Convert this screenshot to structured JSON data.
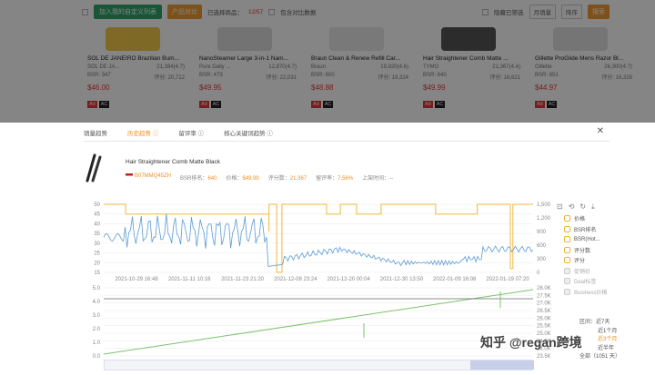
{
  "background": {
    "topbar": {
      "custom_list_button": "加入我的自定义列表",
      "product_button": "产品对比",
      "selected_text": "已选择商品：",
      "selected_count": "12/57",
      "compare_text": "包含对比数据",
      "filter_hidden": "隐藏已筛选",
      "sort_label": "月销量",
      "order_label": "降序",
      "search_button": "搜索"
    },
    "cards": [
      {
        "title": "SOL DE JANEIRO Brazilian Bum...",
        "brand": "SOL DE JA...",
        "rank": "21,384(4.7)",
        "bsr": "BSR: 347",
        "sub": "评分: 20,712",
        "price": "$46.00"
      },
      {
        "title": "NanoSteamer Large 3-in-1 Nam...",
        "brand": "Pure Daily ...",
        "rank": "12,870(4.7)",
        "bsr": "BSR: 473",
        "sub": "评分: 22,031",
        "price": "$49.95"
      },
      {
        "title": "Braun Clean & Renew Refill Car...",
        "brand": "Braun",
        "rank": "19,820(4.6)",
        "bsr": "BSR: 600",
        "sub": "评分: 19,324",
        "price": "$48.88"
      },
      {
        "title": "Hair Straightener Comb Matte ...",
        "brand": "TYMO",
        "rank": "21,367(4.4)",
        "bsr": "BSR: 640",
        "sub": "评分: 16,621",
        "price": "$49.99"
      },
      {
        "title": "Gillette ProGlide Mens Razor Bl...",
        "brand": "Gillette",
        "rank": "26,300(4.7)",
        "bsr": "BSR: 651",
        "sub": "评分: 16,328",
        "price": "$44.97"
      }
    ],
    "tag_ad": "Ad",
    "tag_ac": "AC"
  },
  "panel": {
    "tabs": [
      "销量趋势",
      "历史趋势 ⓘ",
      "留评率 ⓘ",
      "核心关键词趋势 ⓘ"
    ],
    "active_tab": 1,
    "product": {
      "title": "Hair Straightener Comb Matte Black",
      "asin": "B07MMQ45ZH",
      "bsr_label": "BSR排名：",
      "bsr_value": "640",
      "price_label": "价格：",
      "price_value": "$49.99",
      "reviews_label": "评分数：",
      "reviews_value": "21,367",
      "rate_label": "留评率：",
      "rate_value": "7.56%",
      "date_label": "上架时间：",
      "date_value": "--"
    },
    "legend": [
      {
        "label": "价格",
        "on": true
      },
      {
        "label": "BSR排名",
        "on": true
      },
      {
        "label": "BSR(Hot...",
        "on": true
      },
      {
        "label": "评分数",
        "on": true
      },
      {
        "label": "评分",
        "on": true
      },
      {
        "label": "促销价",
        "on": false
      },
      {
        "label": "Deal标签",
        "on": false
      },
      {
        "label": "Business价格",
        "on": false
      }
    ],
    "range_label": "区间：",
    "ranges": [
      "近7天",
      "近1个月",
      "近3个月",
      "近半年",
      "全部（1051 天）"
    ],
    "active_range": 2,
    "watermark": "知乎 @regan跨境"
  },
  "chart_data": {
    "type": "line",
    "x": [
      "2021-10-29 16:48",
      "2021-11-11 10:16",
      "2021-11-23 21:20",
      "2021-12-08 23:24",
      "2021-12-20 00:04",
      "2021-12-30 13:50",
      "2022-01-09 16:08",
      "2022-01-19 07:20"
    ],
    "left_axis_ticks": [
      "50",
      "45",
      "40",
      "35",
      "30",
      "25",
      "20",
      "15"
    ],
    "right_axis_ticks": [
      "1,500",
      "1,200",
      "900",
      "600",
      "300",
      "0"
    ],
    "lower_left_ticks": [
      "5.0",
      "4.0",
      "3.0",
      "2.0",
      "1.0",
      "0.0"
    ],
    "lower_right_ticks": [
      "28.0K",
      "27.5K",
      "27.0K",
      "26.5K",
      "26.0K",
      "25.5K",
      "25.0K",
      "24.5K",
      "24.0K",
      "23.5K"
    ],
    "series": [
      {
        "name": "价格",
        "color": "#f1b739"
      },
      {
        "name": "BSR排名",
        "color": "#5b9bd5"
      },
      {
        "name": "评分数",
        "color": "#7cc36a"
      },
      {
        "name": "评分",
        "color": "#666666"
      }
    ]
  }
}
